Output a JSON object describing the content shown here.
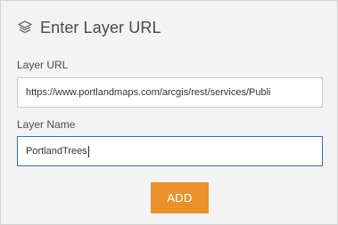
{
  "header": {
    "icon": "layers-icon",
    "title": "Enter Layer URL"
  },
  "layer_url": {
    "label": "Layer URL",
    "value": "https://www.portlandmaps.com/arcgis/rest/services/Publi "
  },
  "layer_name": {
    "label": "Layer Name",
    "value": "PortlandTrees"
  },
  "add_button": {
    "label": "ADD",
    "color": "#e8912d"
  }
}
